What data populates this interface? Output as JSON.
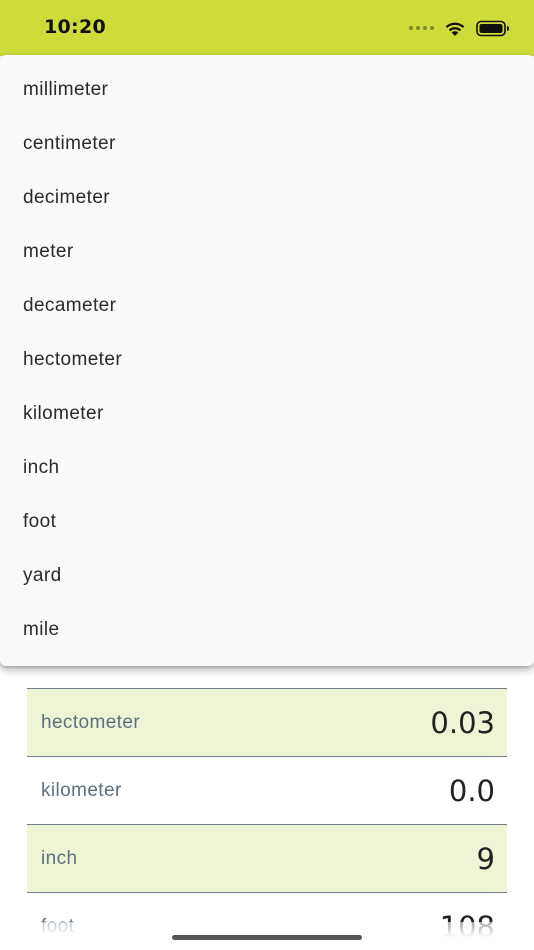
{
  "status_bar": {
    "time": "10:20",
    "background": "#cddc39",
    "icons": [
      "signal-dots-icon",
      "wifi-icon",
      "battery-icon"
    ]
  },
  "menu": {
    "items": [
      {
        "label": "millimeter"
      },
      {
        "label": "centimeter"
      },
      {
        "label": "decimeter"
      },
      {
        "label": "meter"
      },
      {
        "label": "decameter"
      },
      {
        "label": "hectometer"
      },
      {
        "label": "kilometer"
      },
      {
        "label": "inch"
      },
      {
        "label": "foot"
      },
      {
        "label": "yard"
      },
      {
        "label": "mile"
      }
    ]
  },
  "results": {
    "rows": [
      {
        "unit": "hectometer",
        "value": "0.03",
        "highlighted": true
      },
      {
        "unit": "kilometer",
        "value": "0.0",
        "highlighted": false
      },
      {
        "unit": "inch",
        "value": "9",
        "highlighted": true
      },
      {
        "unit": "foot",
        "value": "108",
        "highlighted": false
      }
    ],
    "highlight_color": "#f0f4d6"
  }
}
